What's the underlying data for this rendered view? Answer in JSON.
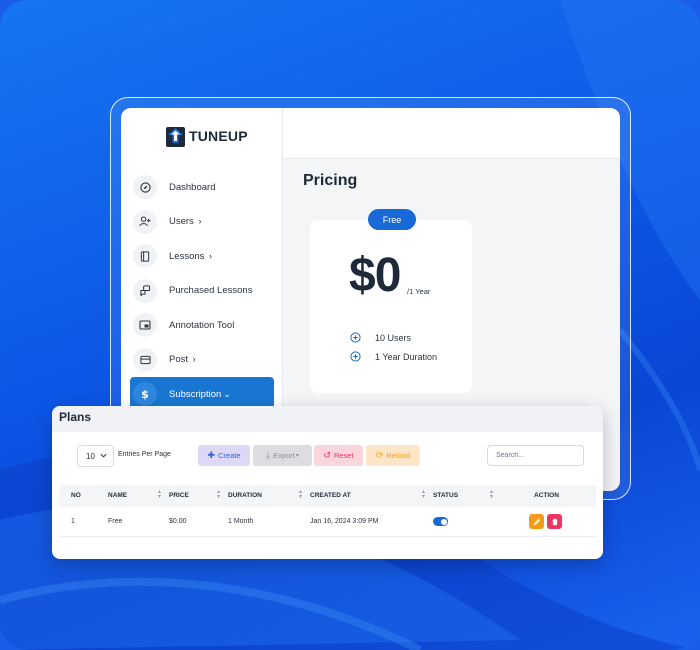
{
  "brand": {
    "name": "TUNE",
    "name_bold": "UP"
  },
  "sidebar": {
    "items": [
      {
        "label": "Dashboard",
        "icon": "compass-icon",
        "chevron": ""
      },
      {
        "label": "Users",
        "icon": "user-add-icon",
        "chevron": "›"
      },
      {
        "label": "Lessons",
        "icon": "book-icon",
        "chevron": "›"
      },
      {
        "label": "Purchased Lessons",
        "icon": "chat-bubbles-icon",
        "chevron": ""
      },
      {
        "label": "Annotation Tool",
        "icon": "screen-icon",
        "chevron": ""
      },
      {
        "label": "Post",
        "icon": "post-icon",
        "chevron": "›"
      },
      {
        "label": "Subscription",
        "icon": "dollar-icon",
        "chevron": "⌄",
        "active": true
      }
    ]
  },
  "main": {
    "title": "Pricing",
    "plan_card": {
      "badge": "Free",
      "price": "$0",
      "period": "/1 Year",
      "features": [
        "10 Users",
        "1 Year Duration"
      ]
    }
  },
  "plans_panel": {
    "title": "Plans",
    "per_page_value": "10",
    "per_page_label": "Entries Per Page",
    "buttons": {
      "create": "Create",
      "export": "Export",
      "reset": "Reset",
      "reload": "Reload"
    },
    "search_placeholder": "Search...",
    "columns": [
      "NO",
      "NAME",
      "PRICE",
      "DURATION",
      "CREATED AT",
      "STATUS",
      "ACTION"
    ],
    "rows": [
      {
        "no": "1",
        "name": "Free",
        "price": "$0.00",
        "duration": "1 Month",
        "created_at": "Jan 16, 2024 3:09 PM",
        "status": "on"
      }
    ]
  },
  "colors": {
    "accent": "#1976d2",
    "create": "#2f62d6",
    "reset": "#ec3560",
    "reload": "#f3a224",
    "edit": "#f59d1b",
    "delete": "#ec3560"
  }
}
